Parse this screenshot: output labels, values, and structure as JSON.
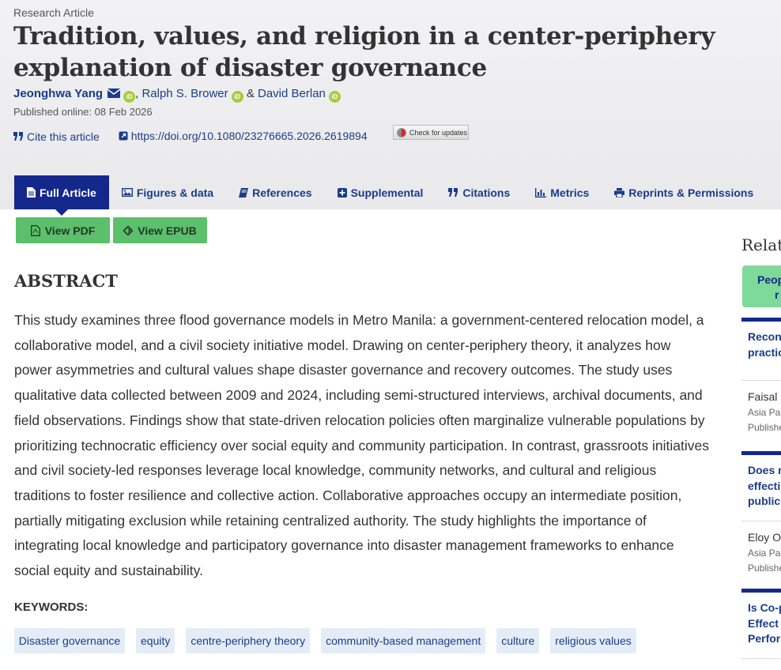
{
  "article": {
    "type": "Research Article",
    "title": "Tradition, values, and religion in a center-periphery explanation of disaster governance",
    "authors": [
      {
        "name": "Jeonghwa Yang",
        "corresponding": true
      },
      {
        "name": "Ralph S. Brower",
        "corresponding": false
      },
      {
        "name": "David Berlan",
        "corresponding": false
      }
    ],
    "orcid_label": "iD",
    "author_separators": [
      ", ",
      " & "
    ],
    "published": "Published online: 08 Feb 2026",
    "cite_label": "Cite this article",
    "doi": "https://doi.org/10.1080/23276665.2026.2619894",
    "check_updates": "Check for updates"
  },
  "tabs": [
    {
      "label": "Full Article",
      "icon": "document-icon",
      "active": true
    },
    {
      "label": "Figures & data",
      "icon": "image-icon"
    },
    {
      "label": "References",
      "icon": "book-icon"
    },
    {
      "label": "Supplemental",
      "icon": "plus-square-icon"
    },
    {
      "label": "Citations",
      "icon": "quote-icon"
    },
    {
      "label": "Metrics",
      "icon": "bar-chart-icon"
    },
    {
      "label": "Reprints & Permissions",
      "icon": "print-icon"
    }
  ],
  "buttons": {
    "view_pdf": "View PDF",
    "view_epub": "View EPUB"
  },
  "abstract": {
    "heading": "ABSTRACT",
    "text": "This study examines three flood governance models in Metro Manila: a government-centered relocation model, a collaborative model, and a civil society initiative model. Drawing on center-periphery theory, it analyzes how power asymmetries and cultural values shape disaster governance and recovery outcomes. The study uses qualitative data collected between 2009 and 2024, including semi-structured interviews, archival documents, and field observations. Findings show that state-driven relocation policies often marginalize vulnerable populations by prioritizing technocratic efficiency over social equity and community participation. In contrast, grassroots initiatives and civil society-led responses leverage local knowledge, community networks, and cultural and religious traditions to foster resilience and collective action. Collaborative approaches occupy an intermediate position, partially mitigating exclusion while retaining centralized authority. The study highlights the importance of integrating local knowledge and participatory governance into disaster management frameworks to enhance social equity and sustainability."
  },
  "keywords": {
    "heading": "KEYWORDS:",
    "items": [
      "Disaster governance",
      "equity",
      "centre-periphery theory",
      "community-based management",
      "culture",
      "religious values"
    ]
  },
  "sidebar": {
    "heading": "Relate",
    "tab_lines": [
      "Peop",
      "r"
    ],
    "cards": [
      {
        "title_lines": [
          "Recon",
          "practic"
        ],
        "author": "Faisal S",
        "journal": "Asia Pac",
        "published": "Publishe"
      },
      {
        "title_lines": [
          "Does r",
          "effecti",
          "public"
        ],
        "author": "Eloy Ol",
        "journal": "Asia Pac",
        "published": "Publishe"
      },
      {
        "title_lines": [
          "Is Co-p",
          "Effect",
          "Perfor"
        ],
        "author": "",
        "journal": "",
        "published": ""
      }
    ]
  },
  "colors": {
    "accent": "#14288c",
    "link": "#1a3c8a",
    "green_button": "#5cbf6b",
    "keyword_bg": "#e4edf7",
    "orcid": "#a6ce39"
  }
}
